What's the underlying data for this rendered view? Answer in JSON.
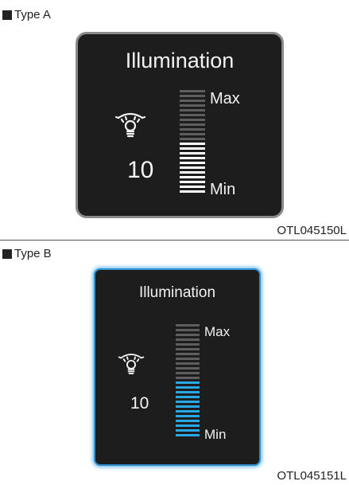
{
  "type_a": {
    "label": "Type A",
    "code": "OTL045150L",
    "panel": {
      "title": "Illumination",
      "level": "10",
      "max_label": "Max",
      "min_label": "Min",
      "icon": "dashboard-bulb-icon",
      "scale_fraction_lit": 0.5,
      "active_color": "#ffffff"
    }
  },
  "type_b": {
    "label": "Type B",
    "code": "OTL045151L",
    "panel": {
      "title": "Illumination",
      "level": "10",
      "max_label": "Max",
      "min_label": "Min",
      "icon": "dashboard-bulb-icon",
      "scale_fraction_lit": 0.5,
      "active_color": "#29a8e6"
    }
  }
}
